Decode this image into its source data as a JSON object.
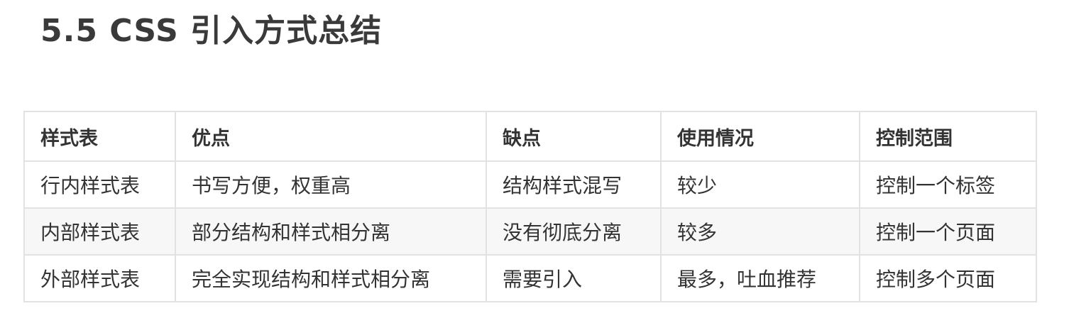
{
  "title": "5.5 CSS 引入方式总结",
  "table": {
    "headers": [
      "样式表",
      "优点",
      "缺点",
      "使用情况",
      "控制范围"
    ],
    "rows": [
      [
        "行内样式表",
        "书写方便，权重高",
        "结构样式混写",
        "较少",
        "控制一个标签"
      ],
      [
        "内部样式表",
        "部分结构和样式相分离",
        "没有彻底分离",
        "较多",
        "控制一个页面"
      ],
      [
        "外部样式表",
        "完全实现结构和样式相分离",
        "需要引入",
        "最多，吐血推荐",
        "控制多个页面"
      ]
    ]
  }
}
